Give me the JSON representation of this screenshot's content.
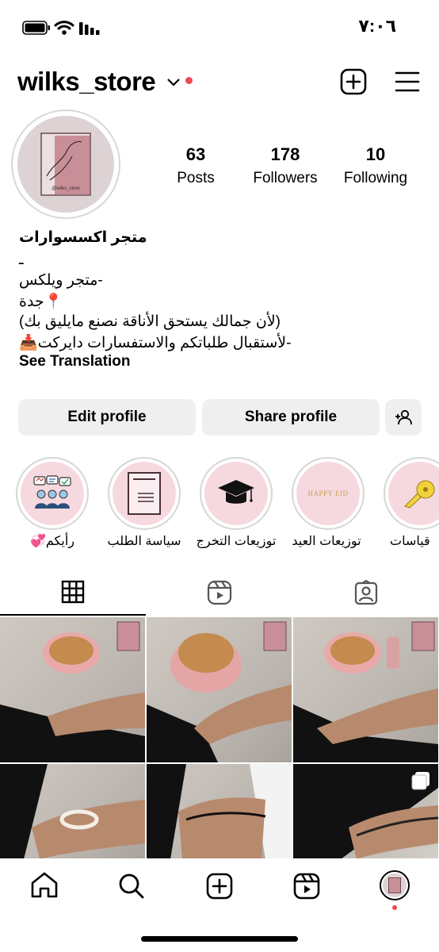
{
  "status_bar": {
    "time": "٧:٠٦"
  },
  "header": {
    "username": "wilks_store"
  },
  "profile": {
    "avatar_caption": "@wilks_store",
    "stats": [
      {
        "value": "63",
        "label": "Posts"
      },
      {
        "value": "178",
        "label": "Followers"
      },
      {
        "value": "10",
        "label": "Following"
      }
    ],
    "name": "متجر اكسسوارات",
    "bio_lines": [
      "ـ",
      "-متجر ويلكس",
      "📍جدة",
      "(لأن جمالك يستحق الأناقة نصنع مايليق بك)",
      "-لأستقبال طلباتكم والاستفسارات دايركت📥"
    ],
    "see_translation": "See Translation"
  },
  "actions": {
    "edit_profile": "Edit profile",
    "share_profile": "Share profile"
  },
  "highlights": [
    {
      "label": "رأيكم💞",
      "icon": "feedback-icon"
    },
    {
      "label": "سياسة الطلب",
      "icon": "document-icon"
    },
    {
      "label": "توزيعات التخرج",
      "icon": "graduation-cap-icon"
    },
    {
      "label": "توزيعات العيد",
      "icon": "happy-eid-icon",
      "text": "HAPPY EID"
    },
    {
      "label": "قياسات",
      "icon": "measuring-tape-icon"
    }
  ],
  "tabs": [
    "grid-tab",
    "reels-tab",
    "tagged-tab"
  ],
  "colors": {
    "accent_red": "#ed4956",
    "pink": "#f6d9df",
    "button_gray": "#efefef"
  }
}
